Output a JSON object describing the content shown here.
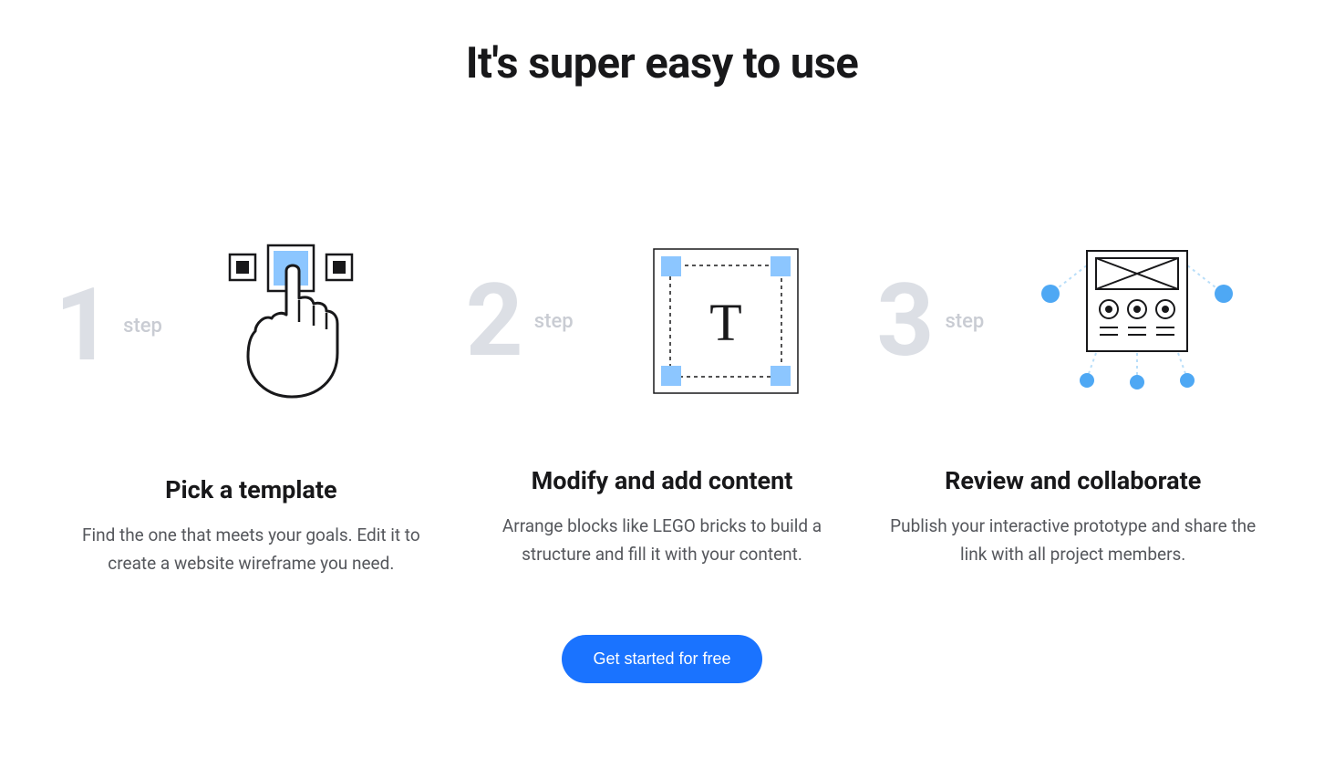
{
  "heading": "It's super easy to use",
  "step_label": "step",
  "steps": [
    {
      "number": "1",
      "title": "Pick a template",
      "description": "Find the one that meets your goals. Edit it to create a website wireframe you need."
    },
    {
      "number": "2",
      "title": "Modify and add content",
      "description": "Arrange blocks like LEGO bricks to build a structure and fill it with your content."
    },
    {
      "number": "3",
      "title": "Review and collaborate",
      "description": "Publish your interactive prototype and share the link with all project members."
    }
  ],
  "cta": "Get started for free"
}
